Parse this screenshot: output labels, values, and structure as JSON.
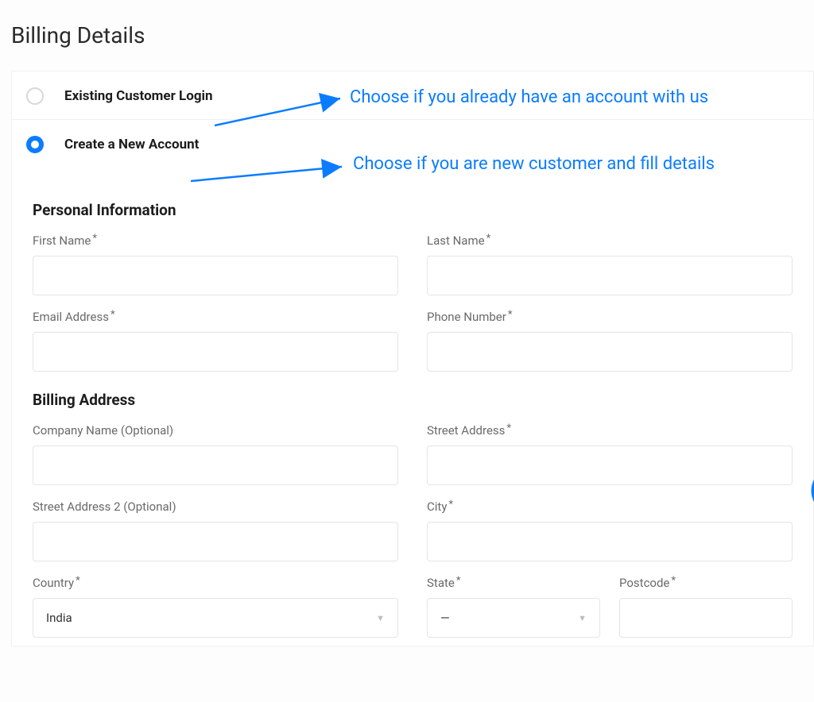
{
  "title": "Billing Details",
  "options": {
    "existing": "Existing Customer Login",
    "create": "Create a New Account"
  },
  "annotations": {
    "existing": "Choose if you already have an account with us",
    "create": "Choose if you are new customer and fill details"
  },
  "sections": {
    "personal": "Personal Information",
    "billing": "Billing Address"
  },
  "labels": {
    "first_name": "First Name",
    "last_name": "Last Name",
    "email": "Email Address",
    "phone": "Phone Number",
    "company": "Company Name (Optional)",
    "street": "Street Address",
    "street2": "Street Address 2 (Optional)",
    "city": "City",
    "country": "Country",
    "state": "State",
    "postcode": "Postcode",
    "required": "*"
  },
  "values": {
    "first_name": "",
    "last_name": "",
    "email": "",
    "phone": "",
    "company": "",
    "street": "",
    "street2": "",
    "city": "",
    "country": "India",
    "state": "—",
    "postcode": ""
  }
}
